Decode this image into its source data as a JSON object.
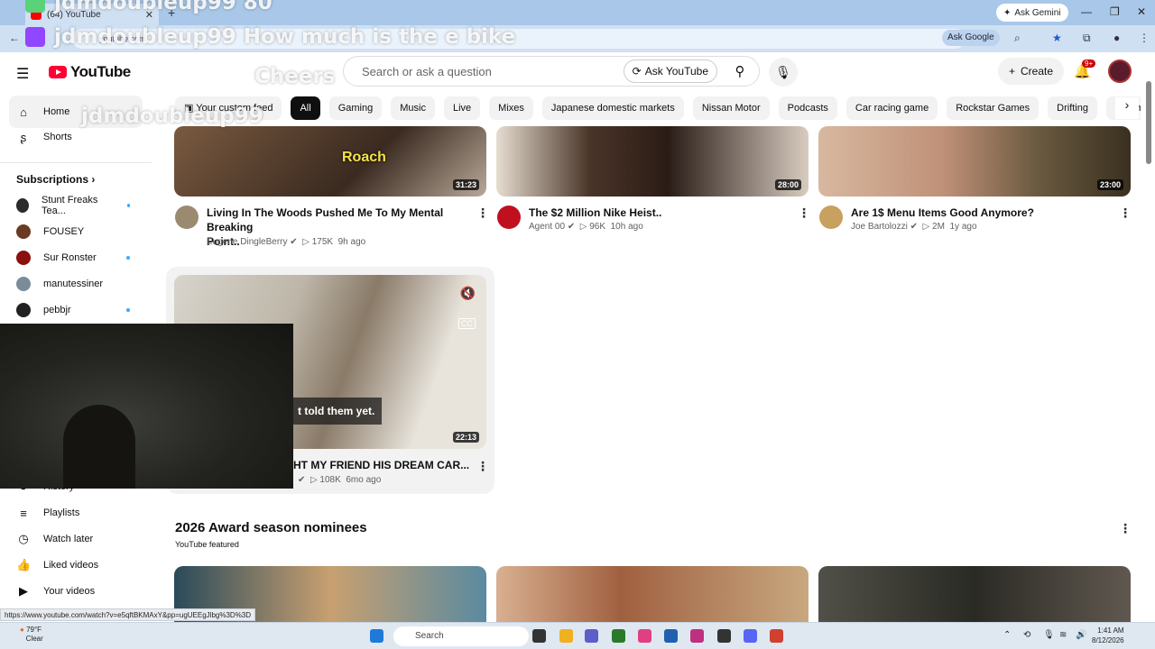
{
  "browser": {
    "tab_title": "(64) YouTube",
    "ask_gemini": "Ask Gemini",
    "url_display": "youtube.com",
    "ask_google": "Ask Google",
    "status_url": "https://www.youtube.com/watch?v=e5qftBKMAxY&pp=ugUEEgJlbg%3D%3D"
  },
  "overlay": {
    "line1": "jdmdoubleup99  80",
    "line2": "jdmdoubleup99   How much is the e bike",
    "line3": "Cheers",
    "line4": "jdmdoubleup99"
  },
  "header": {
    "logo_text": "YouTube",
    "search_placeholder": "Search or ask a question",
    "ask_youtube": "Ask YouTube",
    "create": "Create",
    "notif_count": "9+"
  },
  "sidebar": {
    "home": "Home",
    "shorts": "Shorts",
    "subscriptions": "Subscriptions",
    "subs": [
      {
        "name": "Stunt Freaks Tea...",
        "color": "#2b2b2b"
      },
      {
        "name": "FOUSEY",
        "color": "#6a3a22"
      },
      {
        "name": "Sur Ronster",
        "color": "#8a1010"
      },
      {
        "name": "manutessiner",
        "color": "#7a8c99"
      },
      {
        "name": "pebbjr",
        "color": "#222222"
      }
    ],
    "history": "History",
    "playlists": "Playlists",
    "watch_later": "Watch later",
    "liked_videos": "Liked videos",
    "your_videos": "Your videos"
  },
  "chips": [
    "Your custom feed",
    "All",
    "Gaming",
    "Music",
    "Live",
    "Mixes",
    "Japanese domestic markets",
    "Nissan Motor",
    "Podcasts",
    "Car racing game",
    "Rockstar Games",
    "Drifting",
    "Automobile repair"
  ],
  "videos": [
    {
      "title1": "Living In The Woods Pushed Me To My Mental Breaking",
      "title2": "Point..",
      "channel": "Eugene DingleBerry",
      "views": "175K",
      "age": "9h ago",
      "duration": "31:23",
      "thumb_label": "Roach"
    },
    {
      "title1": "The $2 Million Nike Heist..",
      "title2": "",
      "channel": "Agent 00",
      "views": "96K",
      "age": "10h ago",
      "duration": "28:00"
    },
    {
      "title1": "Are 1$ Menu Items Good Anymore?",
      "title2": "",
      "channel": "Joe Bartolozzi",
      "views": "2M",
      "age": "1y ago",
      "duration": "23:00"
    },
    {
      "title1": "HT MY FRIEND HIS DREAM CAR...",
      "title2": "",
      "channel": "",
      "views": "108K",
      "age": "6mo ago",
      "duration": "22:13",
      "caption": "t told them yet."
    }
  ],
  "section": {
    "title": "2026 Award season nominees",
    "subtitle": "YouTube featured"
  },
  "taskbar": {
    "temp": "79°F",
    "cond": "Clear",
    "search": "Search",
    "time": "1:41 AM",
    "date": "8/12/2026"
  }
}
